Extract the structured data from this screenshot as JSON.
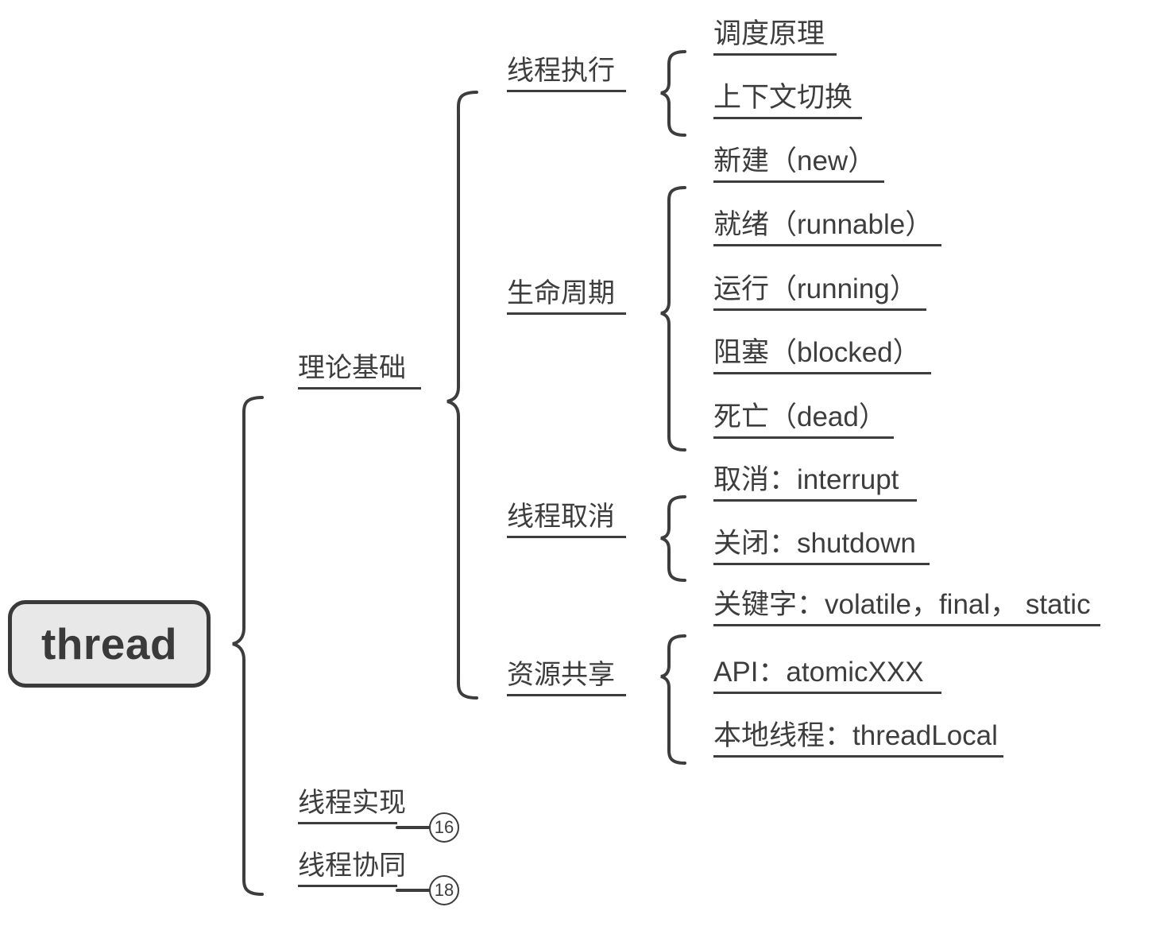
{
  "diagram": {
    "type": "mind-map",
    "title": "thread",
    "stroke_color": "#3d3d3d",
    "root_fill": "#e8e8e8",
    "background": "#ffffff"
  },
  "root": {
    "label": "thread"
  },
  "branches": {
    "theory": {
      "label": "理论基础",
      "children": {
        "execution": {
          "label": "线程执行",
          "leaves": [
            {
              "label": "调度原理"
            },
            {
              "label": "上下文切换"
            }
          ]
        },
        "lifecycle": {
          "label": "生命周期",
          "leaves": [
            {
              "label": "新建（new）"
            },
            {
              "label": "就绪（runnable）"
            },
            {
              "label": "运行（running）"
            },
            {
              "label": "阻塞（blocked）"
            },
            {
              "label": "死亡（dead）"
            }
          ]
        },
        "cancel": {
          "label": "线程取消",
          "leaves": [
            {
              "label": "取消：interrupt"
            },
            {
              "label": "关闭：shutdown"
            }
          ]
        },
        "sharing": {
          "label": "资源共享",
          "leaves": [
            {
              "label": "关键字：volatile，final， static"
            },
            {
              "label": "API：atomicXXX"
            },
            {
              "label": "本地线程：threadLocal"
            }
          ]
        }
      }
    },
    "implementation": {
      "label": "线程实现",
      "badge": "16"
    },
    "coordination": {
      "label": "线程协同",
      "badge": "18"
    }
  }
}
